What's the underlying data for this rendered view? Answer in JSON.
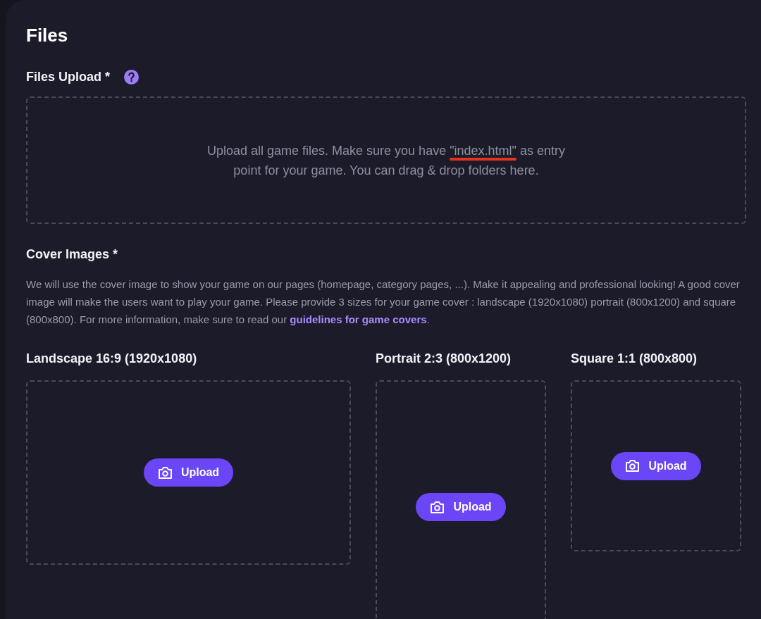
{
  "section_title": "Files",
  "files_upload": {
    "label": "Files Upload *",
    "help": true,
    "text_parts": [
      {
        "text": "Upload all game files. Make sure you have ",
        "underlined": false
      },
      {
        "text": "\"index.html\"",
        "underlined": true
      },
      {
        "text": " as entry point for your game. You can drag & drop folders here.",
        "underlined": false
      }
    ]
  },
  "cover_images": {
    "label": "Cover Images *",
    "description": {
      "text": "We will use the cover image to show your game on our pages (homepage, category pages, ...). Make it appealing and professional looking! A good cover image will make the users want to play your game. Please provide 3 sizes for your game cover : landscape (1920x1080) portrait (800x1200) and square (800x800). For more information, make sure to read our ",
      "link": "guidelines for game covers",
      "after": "."
    },
    "slots": [
      {
        "kind": "landscape",
        "label": "Landscape 16:9 (1920x1080)",
        "button": "Upload"
      },
      {
        "kind": "portrait",
        "label": "Portrait 2:3 (800x1200)",
        "button": "Upload"
      },
      {
        "kind": "square",
        "label": "Square 1:1 (800x800)",
        "button": "Upload"
      }
    ]
  }
}
